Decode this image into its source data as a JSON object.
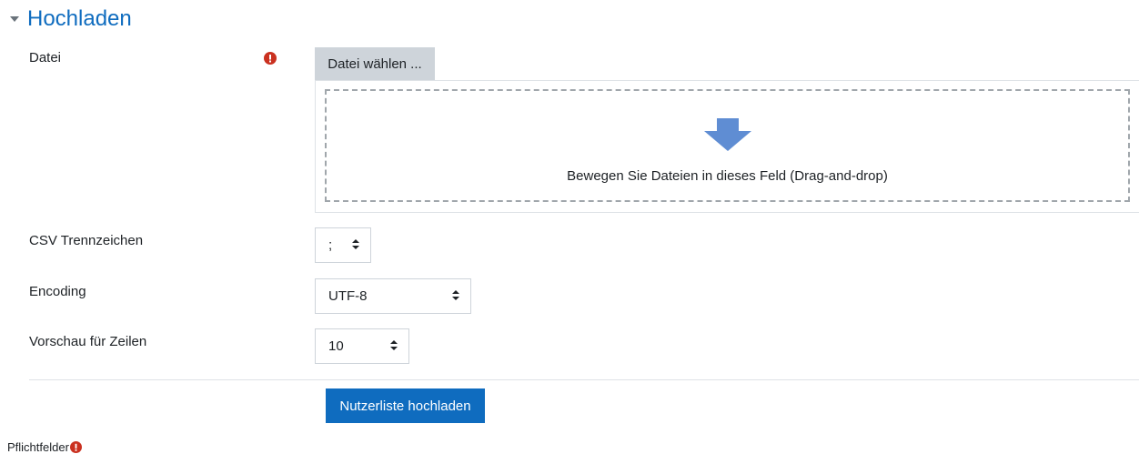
{
  "section": {
    "title": "Hochladen"
  },
  "form": {
    "file_label": "Datei",
    "file_choose_button": "Datei wählen ...",
    "dropzone_text": "Bewegen Sie Dateien in dieses Feld (Drag-and-drop)",
    "csv_delimiter_label": "CSV Trennzeichen",
    "csv_delimiter_value": ";",
    "encoding_label": "Encoding",
    "encoding_value": "UTF-8",
    "preview_rows_label": "Vorschau für Zeilen",
    "preview_rows_value": "10",
    "submit_label": "Nutzerliste hochladen"
  },
  "footer": {
    "required_fields_label": "Pflichtfelder"
  },
  "colors": {
    "brand": "#0f6cbf",
    "required": "#ca3120",
    "dropzone_arrow": "#5f8dd3"
  },
  "icons": {
    "section_toggle": "chevron-down-icon",
    "required": "exclamation-circle-icon",
    "dropzone": "arrow-down-icon",
    "select": "sort-arrows-icon"
  }
}
